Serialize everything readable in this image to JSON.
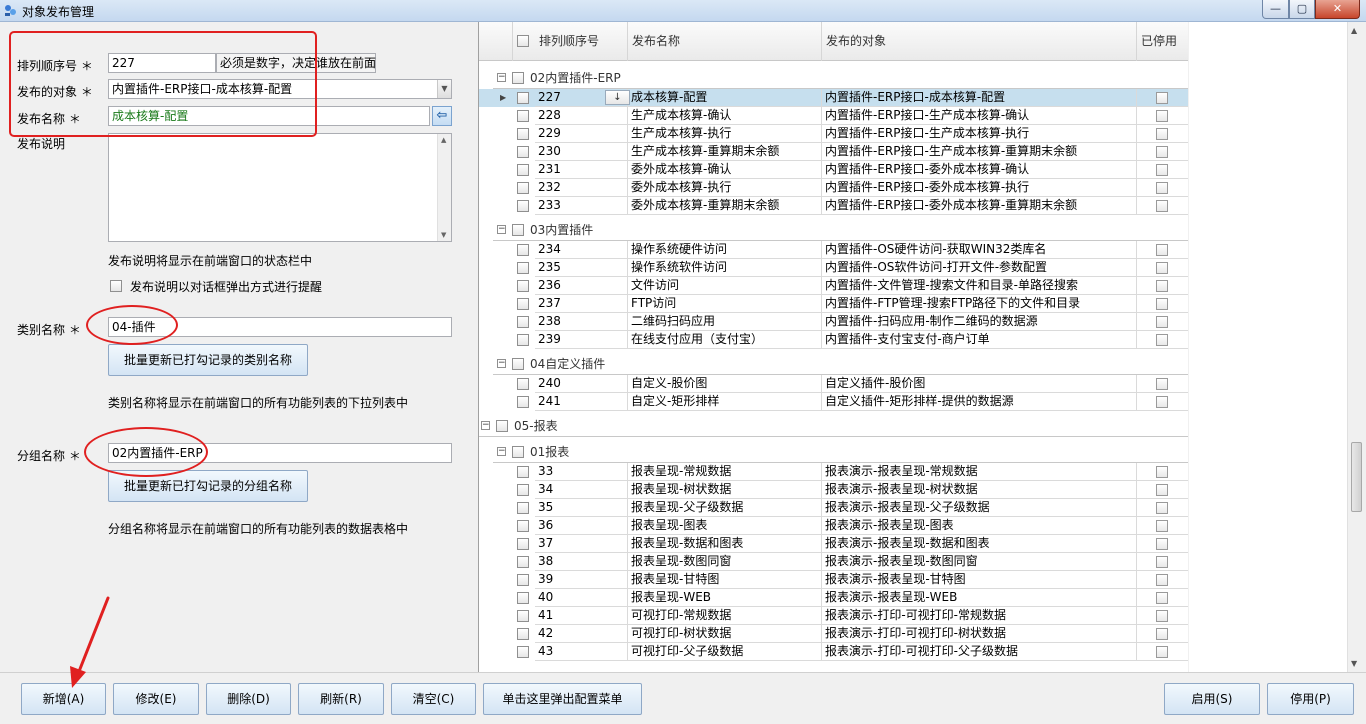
{
  "window": {
    "title": "对象发布管理",
    "min_glyph": "—",
    "max_glyph": "▢",
    "close_glyph": "✕"
  },
  "form": {
    "seq_label": "排列顺序号 ＊",
    "seq_value": "227",
    "seq_hint": "必须是数字，决定谁放在前面",
    "target_label": "发布的对象 ＊",
    "target_value": "内置插件-ERP接口-成本核算-配置",
    "name_label": "发布名称 ＊",
    "name_value": "成本核算-配置",
    "desc_label": "发布说明",
    "desc_value": "",
    "desc_hint": "发布说明将显示在前端窗口的状态栏中",
    "popup_label": "发布说明以对话框弹出方式进行提醒",
    "category_label": "类别名称 ＊",
    "category_value": "04-插件",
    "category_batch_button": "批量更新已打勾记录的类别名称",
    "category_hint": "类别名称将显示在前端窗口的所有功能列表的下拉列表中",
    "group_label": "分组名称 ＊",
    "group_value": "02内置插件-ERP",
    "group_batch_button": "批量更新已打勾记录的分组名称",
    "group_hint": "分组名称将显示在前端窗口的所有功能列表的数据表格中"
  },
  "grid": {
    "columns": [
      "排列顺序号",
      "发布名称",
      "发布的对象",
      "已停用"
    ],
    "groups": [
      {
        "title": "02内置插件-ERP",
        "level": 2,
        "rows": [
          {
            "seq": "227",
            "name": "成本核算-配置",
            "target": "内置插件-ERP接口-成本核算-配置",
            "selected": true
          },
          {
            "seq": "228",
            "name": "生产成本核算-确认",
            "target": "内置插件-ERP接口-生产成本核算-确认"
          },
          {
            "seq": "229",
            "name": "生产成本核算-执行",
            "target": "内置插件-ERP接口-生产成本核算-执行"
          },
          {
            "seq": "230",
            "name": "生产成本核算-重算期末余额",
            "target": "内置插件-ERP接口-生产成本核算-重算期末余额"
          },
          {
            "seq": "231",
            "name": "委外成本核算-确认",
            "target": "内置插件-ERP接口-委外成本核算-确认"
          },
          {
            "seq": "232",
            "name": "委外成本核算-执行",
            "target": "内置插件-ERP接口-委外成本核算-执行"
          },
          {
            "seq": "233",
            "name": "委外成本核算-重算期末余额",
            "target": "内置插件-ERP接口-委外成本核算-重算期末余额"
          }
        ]
      },
      {
        "title": "03内置插件",
        "level": 2,
        "rows": [
          {
            "seq": "234",
            "name": "操作系统硬件访问",
            "target": "内置插件-OS硬件访问-获取WIN32类库名"
          },
          {
            "seq": "235",
            "name": "操作系统软件访问",
            "target": "内置插件-OS软件访问-打开文件-参数配置"
          },
          {
            "seq": "236",
            "name": "文件访问",
            "target": "内置插件-文件管理-搜索文件和目录-单路径搜索"
          },
          {
            "seq": "237",
            "name": "FTP访问",
            "target": "内置插件-FTP管理-搜索FTP路径下的文件和目录"
          },
          {
            "seq": "238",
            "name": "二维码扫码应用",
            "target": "内置插件-扫码应用-制作二维码的数据源"
          },
          {
            "seq": "239",
            "name": "在线支付应用（支付宝）",
            "target": "内置插件-支付宝支付-商户订单"
          }
        ]
      },
      {
        "title": "04自定义插件",
        "level": 2,
        "rows": [
          {
            "seq": "240",
            "name": "自定义-股价图",
            "target": "自定义插件-股价图"
          },
          {
            "seq": "241",
            "name": "自定义-矩形排样",
            "target": "自定义插件-矩形排样-提供的数据源"
          }
        ]
      },
      {
        "title": "05-报表",
        "level": 1,
        "rows": []
      },
      {
        "title": "01报表",
        "level": 2,
        "rows": [
          {
            "seq": "33",
            "name": "报表呈现-常规数据",
            "target": "报表演示-报表呈现-常规数据"
          },
          {
            "seq": "34",
            "name": "报表呈现-树状数据",
            "target": "报表演示-报表呈现-树状数据"
          },
          {
            "seq": "35",
            "name": "报表呈现-父子级数据",
            "target": "报表演示-报表呈现-父子级数据"
          },
          {
            "seq": "36",
            "name": "报表呈现-图表",
            "target": "报表演示-报表呈现-图表"
          },
          {
            "seq": "37",
            "name": "报表呈现-数据和图表",
            "target": "报表演示-报表呈现-数据和图表"
          },
          {
            "seq": "38",
            "name": "报表呈现-数图同窗",
            "target": "报表演示-报表呈现-数图同窗"
          },
          {
            "seq": "39",
            "name": "报表呈现-甘特图",
            "target": "报表演示-报表呈现-甘特图"
          },
          {
            "seq": "40",
            "name": "报表呈现-WEB",
            "target": "报表演示-报表呈现-WEB"
          },
          {
            "seq": "41",
            "name": "可视打印-常规数据",
            "target": "报表演示-打印-可视打印-常规数据"
          },
          {
            "seq": "42",
            "name": "可视打印-树状数据",
            "target": "报表演示-打印-可视打印-树状数据"
          },
          {
            "seq": "43",
            "name": "可视打印-父子级数据",
            "target": "报表演示-打印-可视打印-父子级数据"
          }
        ]
      }
    ]
  },
  "toolbar": {
    "add": "新增(A)",
    "edit": "修改(E)",
    "delete": "删除(D)",
    "refresh": "刷新(R)",
    "clear": "清空(C)",
    "menu": "单击这里弹出配置菜单",
    "enable": "启用(S)",
    "disable": "停用(P)"
  },
  "colors": {
    "annotation_red": "#e02020",
    "selected_row": "#c6dfee",
    "name_text_green": "#1a7a1a"
  }
}
